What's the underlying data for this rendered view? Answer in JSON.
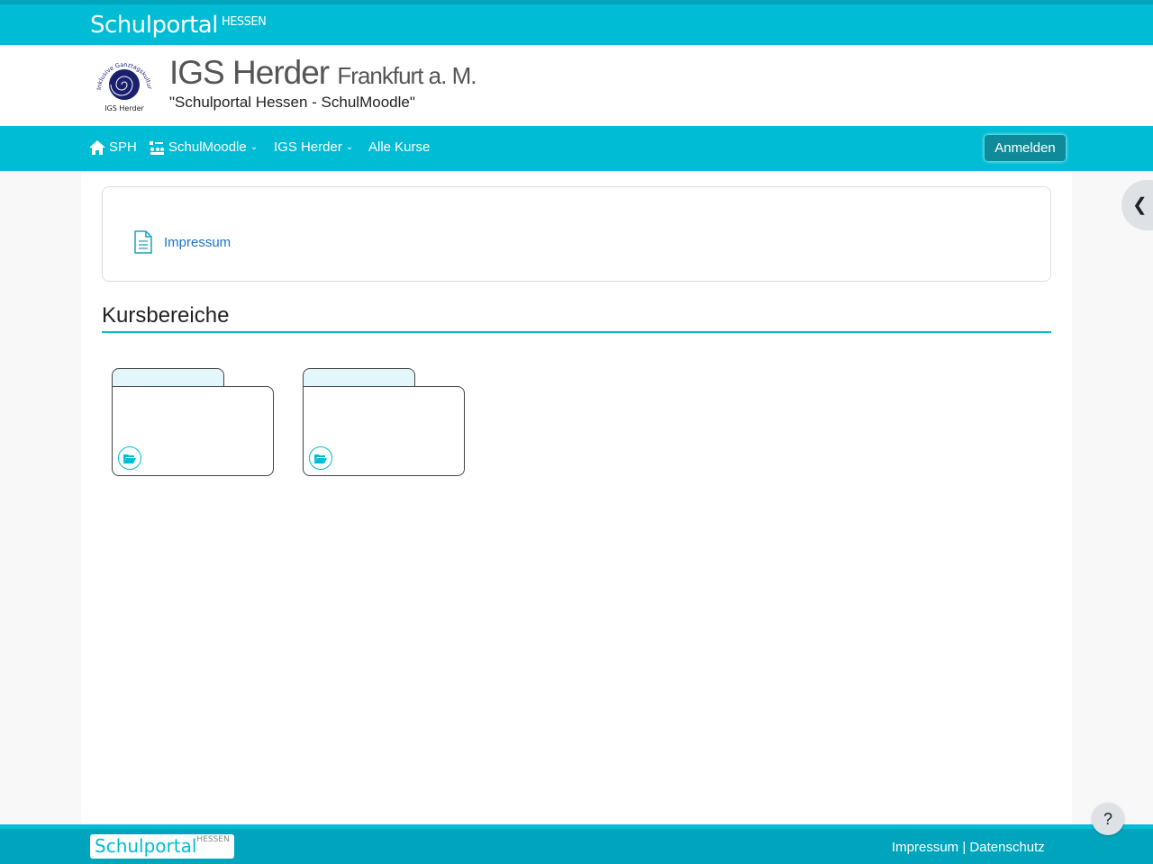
{
  "topbar": {
    "brand": "Schulportal",
    "brand_sup": "HESSEN"
  },
  "header": {
    "school": "IGS Herder",
    "city": "Frankfurt a. M.",
    "subtitle": "\"Schulportal Hessen - SchulMoodle\"",
    "logo_text": "IGS Herder",
    "logo_arc": "Inklusive Ganztagskulturschule"
  },
  "nav": {
    "items": [
      {
        "label": "SPH",
        "icon": "home-icon"
      },
      {
        "label": "SchulMoodle",
        "icon": "moodle-icon"
      },
      {
        "label": "IGS Herder"
      },
      {
        "label": "Alle Kurse"
      }
    ],
    "login": "Anmelden"
  },
  "main": {
    "impressum": "Impressum",
    "section_title": "Kursbereiche"
  },
  "footer": {
    "brand": "Schulportal",
    "brand_sup": "HESSEN",
    "impressum": "Impressum",
    "sep": " | ",
    "datenschutz": "Datenschutz"
  },
  "help": "?",
  "colors": {
    "accent": "#00bcd4",
    "link": "#1a73c9"
  }
}
